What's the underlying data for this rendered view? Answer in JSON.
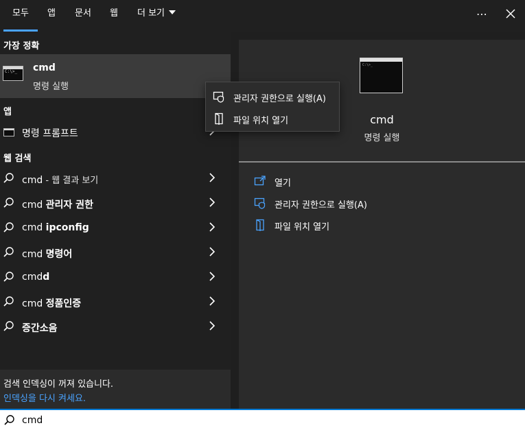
{
  "tabs": [
    {
      "label": "모두",
      "active": true
    },
    {
      "label": "앱"
    },
    {
      "label": "문서"
    },
    {
      "label": "웹"
    },
    {
      "label": "더 보기"
    }
  ],
  "icons": {
    "more": "ellipsis-icon",
    "close": "close-icon"
  },
  "best_match": {
    "title": "가장 정확",
    "name": "cmd",
    "subtitle": "명령 실행",
    "thumb_prompt": "C:\\>_"
  },
  "apps": {
    "title": "앱",
    "items": [
      {
        "label": "명령 프롬프트"
      }
    ]
  },
  "web": {
    "title": "웹 검색",
    "items": [
      {
        "prefix": "cmd",
        "bold": "",
        "suffix": " - 웹 결과 보기"
      },
      {
        "prefix": "cmd ",
        "bold": "관리자 권한",
        "suffix": ""
      },
      {
        "prefix": "cmd ",
        "bold": "ipconfig",
        "suffix": ""
      },
      {
        "prefix": "cmd ",
        "bold": "명령어",
        "suffix": ""
      },
      {
        "prefix": "cmd",
        "bold": "d",
        "suffix": ""
      },
      {
        "prefix": "cmd ",
        "bold": "정품인증",
        "suffix": ""
      },
      {
        "prefix": "",
        "bold": "증간소음",
        "suffix": ""
      }
    ]
  },
  "index_note": {
    "line1": "검색 인덱싱이 꺼져 있습니다.",
    "link": "인덱싱을 다시 켜세요."
  },
  "context_menu": {
    "items": [
      {
        "label": "관리자 권한으로 실행(A)",
        "icon": "shield-icon"
      },
      {
        "label": "파일 위치 열기",
        "icon": "folder-icon"
      }
    ]
  },
  "detail": {
    "name": "cmd",
    "subtitle": "명령 실행",
    "thumb_prompt": "C:\\>_",
    "actions": [
      {
        "label": "열기",
        "icon": "open-icon"
      },
      {
        "label": "관리자 권한으로 실행(A)",
        "icon": "shield-icon"
      },
      {
        "label": "파일 위치 열기",
        "icon": "folder-icon"
      }
    ]
  },
  "search": {
    "value": "cmd"
  },
  "colors": {
    "accent": "#4aa3ff",
    "background": "#202020",
    "selected": "#3b3b3b"
  }
}
